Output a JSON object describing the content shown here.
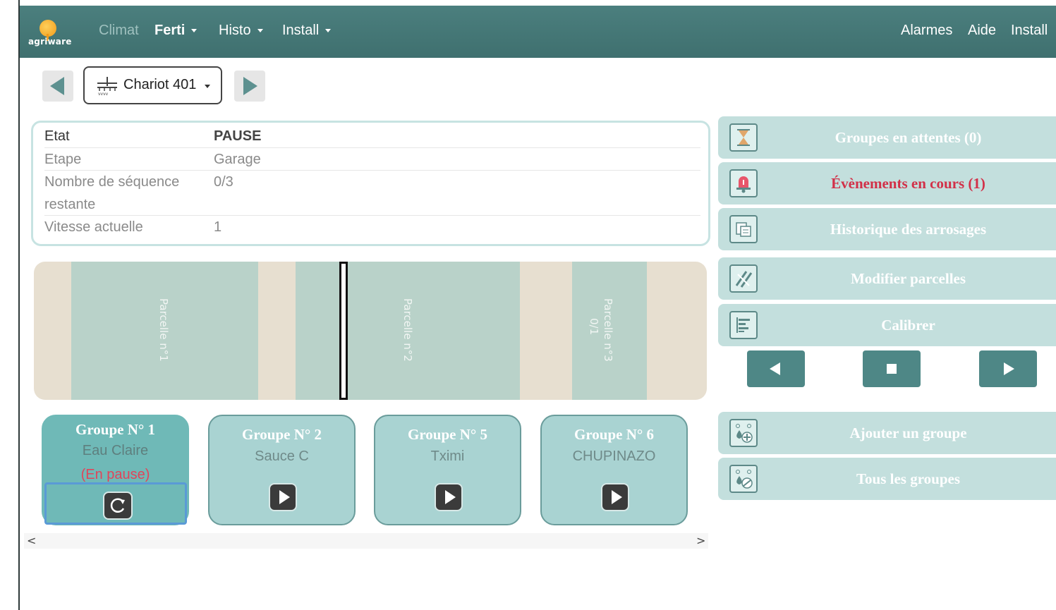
{
  "brand": {
    "name": "agriware"
  },
  "nav": {
    "climat": "Climat",
    "ferti": "Ferti",
    "histo": "Histo",
    "install": "Install",
    "alarmes": "Alarmes",
    "aide": "Aide",
    "install_right": "Install"
  },
  "selector": {
    "label": "Chariot 401"
  },
  "info": [
    {
      "key": "Etat",
      "value": "PAUSE"
    },
    {
      "key": "Etape",
      "value": "Garage"
    },
    {
      "key": "Nombre de séquence restante",
      "value": "0/3"
    },
    {
      "key": "Vitesse actuelle",
      "value": "1"
    }
  ],
  "parcels": [
    {
      "label": "Parcelle n°1"
    },
    {
      "label": "Parcelle n°2"
    },
    {
      "label": "Parcelle n°3",
      "sub": "0/1"
    }
  ],
  "groups": [
    {
      "title": "Groupe N° 1",
      "name": "Eau Claire",
      "state": "(En pause)"
    },
    {
      "title": "Groupe N° 2",
      "name": "Sauce C"
    },
    {
      "title": "Groupe N° 5",
      "name": "Tximi"
    },
    {
      "title": "Groupe N° 6",
      "name": "CHUPINAZO"
    }
  ],
  "scroll": {
    "left": "<",
    "right": ">"
  },
  "actions": {
    "waiting": "Groupes en attentes (0)",
    "events": "Évènements en cours (1)",
    "history": "Historique des arrosages",
    "modify": "Modifier parcelles",
    "calibrate": "Calibrer",
    "add_group": "Ajouter un groupe",
    "all_groups": "Tous les groupes"
  },
  "colors": {
    "navbar": "#437574",
    "accent": "#4e8786",
    "alert": "#d23048",
    "card": "#a9d3d2"
  }
}
